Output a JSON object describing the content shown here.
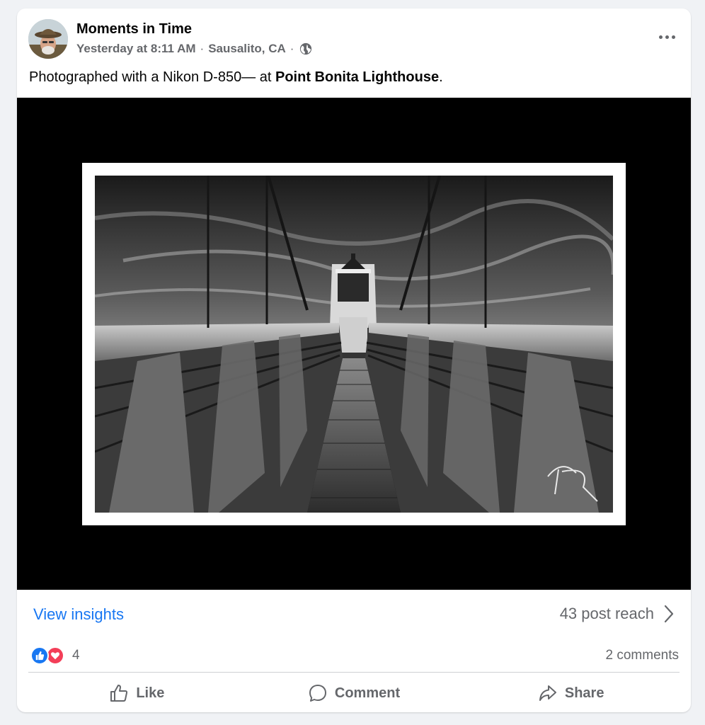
{
  "post": {
    "page_name": "Moments in Time",
    "timestamp": "Yesterday at 8:11 AM",
    "location": "Sausalito, CA",
    "privacy_icon": "globe-icon",
    "caption_prefix": "Photographed with a Nikon D-850— at ",
    "caption_place": "Point Bonita Lighthouse",
    "caption_suffix": "."
  },
  "insights": {
    "view_label": "View insights",
    "reach_label": "43 post reach"
  },
  "engagement": {
    "reaction_icons": [
      "like-reaction-icon",
      "love-reaction-icon"
    ],
    "reaction_count": "4",
    "comments_label": "2 comments"
  },
  "actions": {
    "like_label": "Like",
    "comment_label": "Comment",
    "share_label": "Share"
  },
  "colors": {
    "link": "#1877f2",
    "secondary_text": "#65676b",
    "like_blue": "#1877f2",
    "love_red": "#f33e58"
  }
}
